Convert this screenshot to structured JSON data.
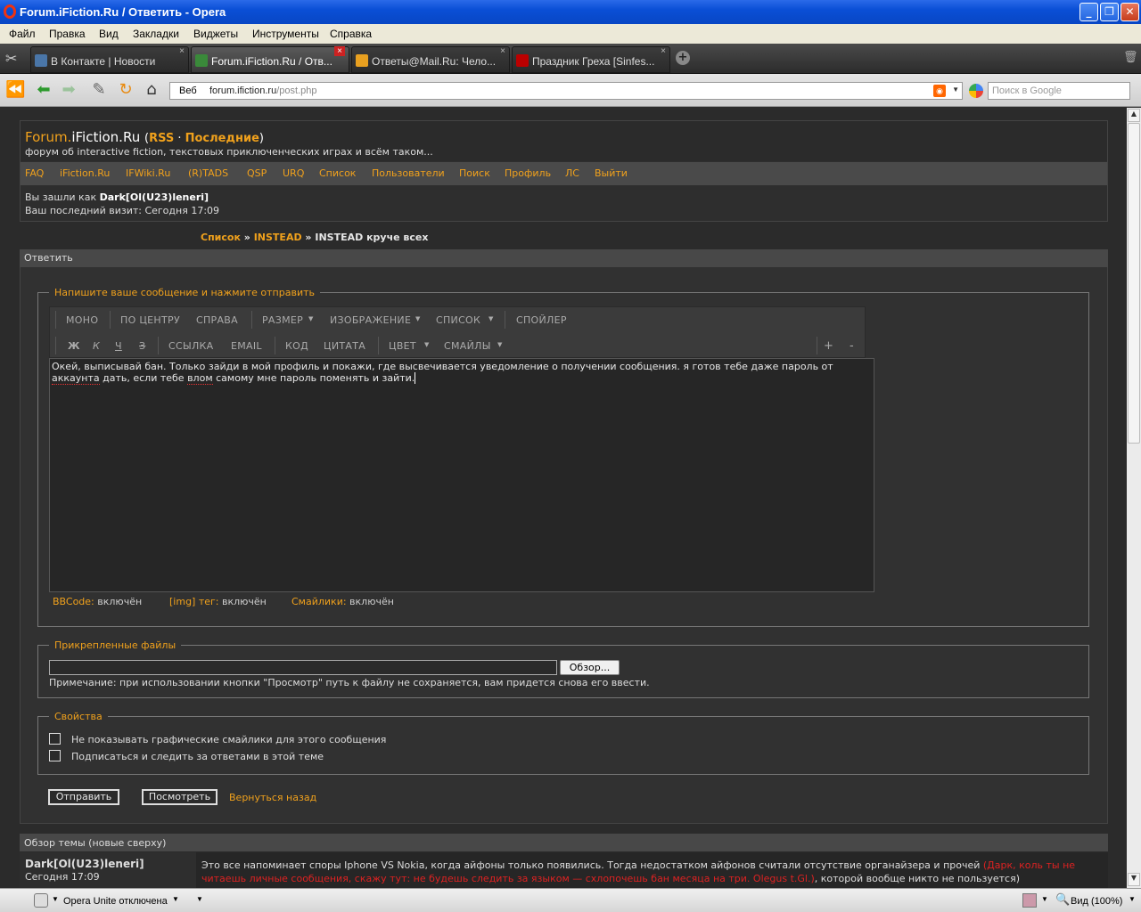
{
  "window": {
    "title": "Forum.iFiction.Ru / Ответить - Opera"
  },
  "menu": [
    "Файл",
    "Правка",
    "Вид",
    "Закладки",
    "Виджеты",
    "Инструменты",
    "Справка"
  ],
  "tabs": [
    {
      "label": "В Контакте | Новости",
      "icon": "vk-icon",
      "color": "#4a76a8"
    },
    {
      "label": "Forum.iFiction.Ru / Отв...",
      "icon": "forum-icon",
      "color": "#3a8a3a"
    },
    {
      "label": "Ответы@Mail.Ru: Чело...",
      "icon": "mailru-icon",
      "color": "#e8a020"
    },
    {
      "label": "Праздник Греха [Sinfes...",
      "icon": "sinfest-icon",
      "color": "#b00"
    }
  ],
  "address": {
    "prefix": "Веб",
    "domain": "forum.ifiction.ru",
    "path": "/post.php",
    "search_placeholder": "Поиск в Google"
  },
  "forum": {
    "brand_a": "Forum.",
    "brand_b": "iFiction.Ru",
    "paren_open": "(",
    "rss": "RSS",
    "dot": " · ",
    "latest": "Последние",
    "paren_close": ")",
    "tagline": "форум об interactive fiction, текстовых приключенческих играх и всём таком...",
    "nav": [
      "FAQ",
      "iFiction.Ru",
      "IFWiki.Ru",
      "(R)TADS",
      "QSP",
      "URQ",
      "Список",
      "Пользователи",
      "Поиск",
      "Профиль",
      "ЛС",
      "Выйти"
    ],
    "login_prefix": "Вы зашли как ",
    "username": "Dark[Ol(U23)leneri]",
    "last_visit": "Ваш последний визит: Сегодня 17:09",
    "crumb_1": "Список",
    "crumb_sep": " » ",
    "crumb_2": "INSTEAD",
    "crumb_3": "INSTEAD круче всех",
    "reply_title": "Ответить"
  },
  "editor": {
    "legend": "Напишите ваше сообщение и нажмите отправить",
    "row1": [
      "МОНО",
      "ПО ЦЕНТРУ",
      "СПРАВА",
      "РАЗМЕР",
      "ИЗОБРАЖЕНИЕ",
      "СПИСОК",
      "СПОЙЛЕР"
    ],
    "row2": [
      "Ж",
      "К",
      "Ч",
      "З",
      "ССЫЛКА",
      "EMAIL",
      "КОД",
      "ЦИТАТА",
      "ЦВЕТ",
      "СМАЙЛЫ",
      "+",
      "-"
    ],
    "text_1": "Окей, выписывай бан. Только зайди в мой профиль и покажи, где высвечивается уведомление о получении сообщения. я готов тебе даже пароль от",
    "text_2a": "аккаунта",
    "text_2b": " дать, если тебе ",
    "text_2c": "влом",
    "text_2d": " самому мне пароль поменять и зайти.",
    "bbcode_label": "BBCode:",
    "bbcode_val": " включён",
    "img_label": "[img] тег:",
    "img_val": " включён",
    "smiles_label": "Смайлики:",
    "smiles_val": " включён"
  },
  "attachments": {
    "legend": "Прикрепленные файлы",
    "browse": "Обзор...",
    "note": "Примечание: при использовании кнопки \"Просмотр\" путь к файлу не сохраняется, вам придется снова его ввести."
  },
  "options": {
    "legend": "Свойства",
    "opt1": "Не показывать графические смайлики для этого сообщения",
    "opt2": "Подписаться и следить за ответами в этой теме"
  },
  "buttons": {
    "submit": "Отправить",
    "preview": "Посмотреть",
    "back": "Вернуться назад"
  },
  "review": {
    "title": "Обзор темы (новые сверху)",
    "user": "Dark[Ol(U23)leneri]",
    "date": "Сегодня 17:09",
    "msg_a": "Это все напоминает споры Iphone VS Nokia, когда айфоны только появились. Тогда недостатком айфонов считали отсутствие органайзера и прочей ",
    "msg_red": "(Дарк, коль ты не читаешь личные сообщения, скажу тут: не будешь следить за языком — схлопочешь бан месяца на три. Olegus t.Gl.)",
    "msg_b": ", которой вообще никто не пользуется)"
  },
  "statusbar": {
    "unite": "Opera Unite отключена",
    "zoom": "Вид (100%)"
  }
}
